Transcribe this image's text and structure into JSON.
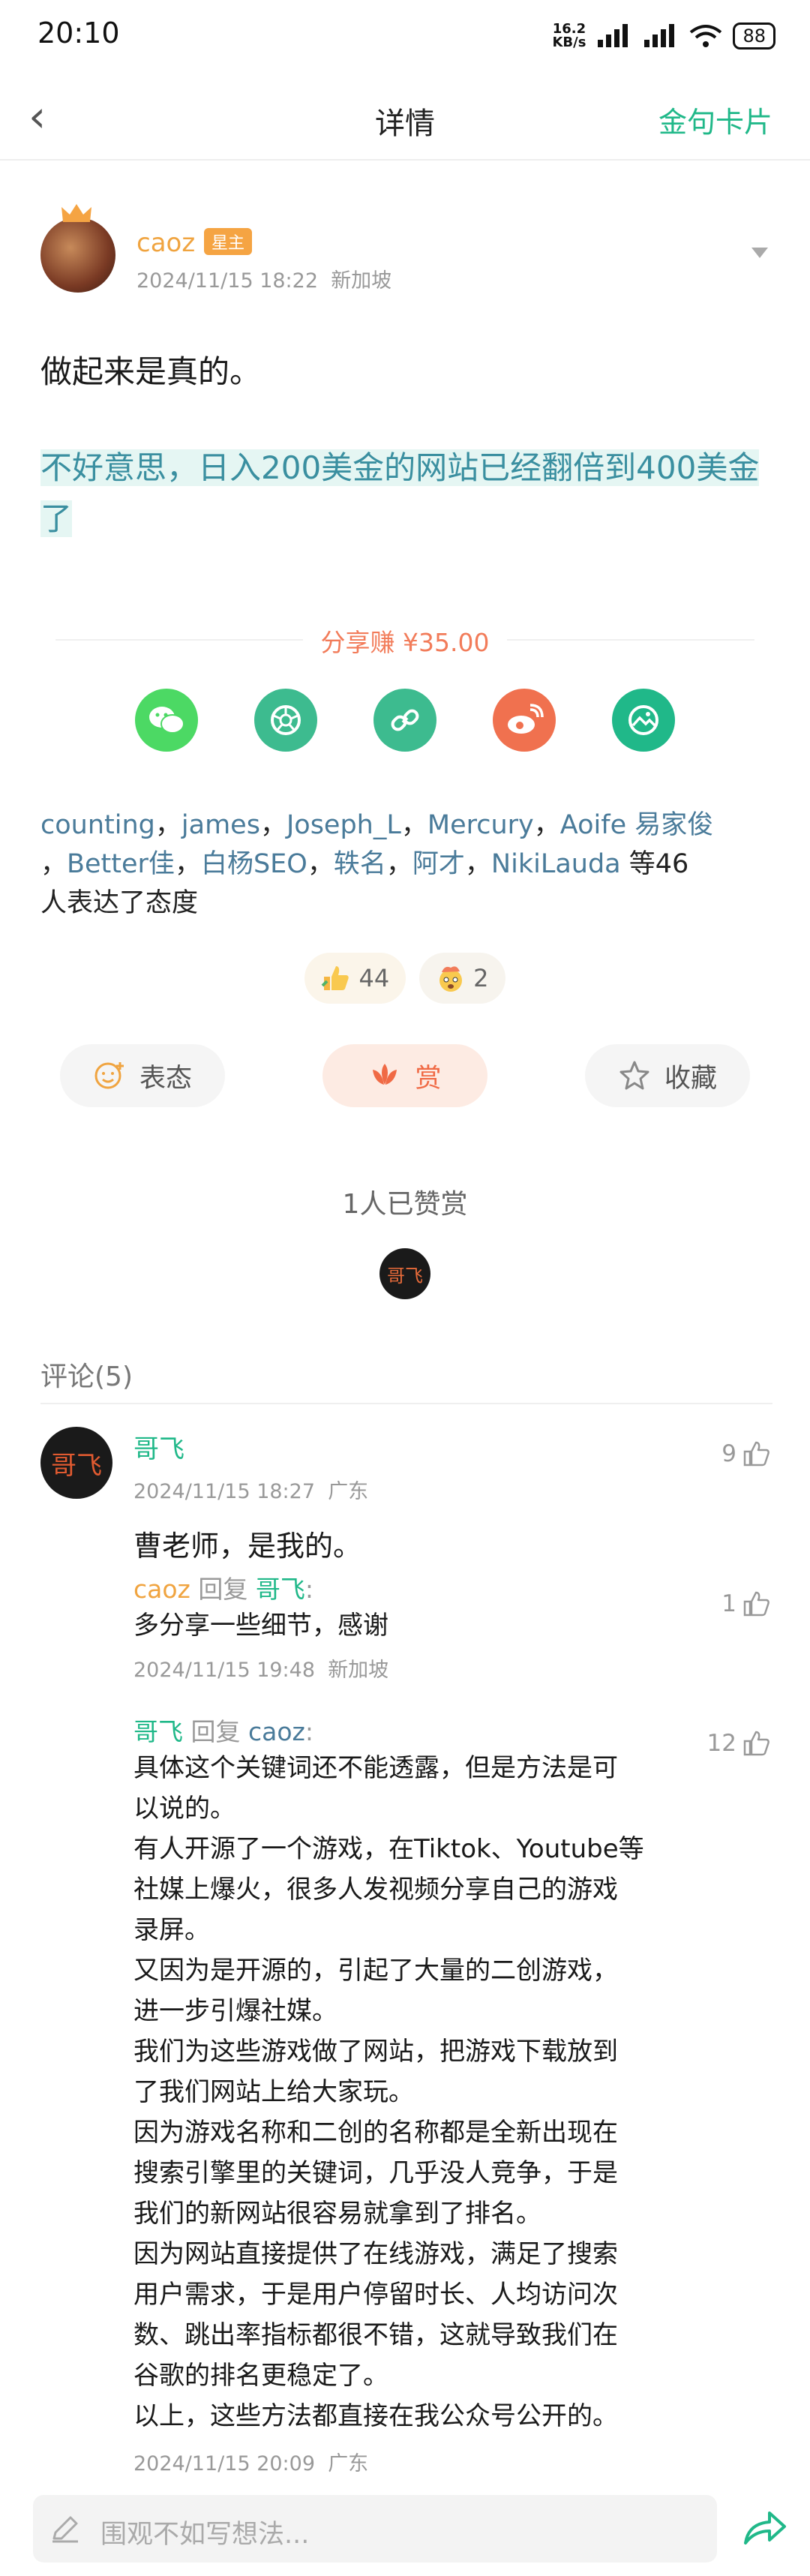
{
  "status_bar": {
    "time": "20:10",
    "speed_value": "16.2",
    "speed_unit": "KB/s",
    "battery": "88"
  },
  "nav": {
    "back_icon": "chevron-left-icon",
    "title": "详情",
    "action": "金句卡片"
  },
  "post": {
    "author": {
      "name": "caoz",
      "badge": "星主",
      "time": "2024/11/15 18:22",
      "location": "新加坡"
    },
    "text_line1": "做起来是真的。",
    "highlight": "不好意思，日入200美金的网站已经翻倍到400美金了"
  },
  "share": {
    "label": "分享赚 ¥35.00",
    "icons": [
      {
        "name": "wechat-icon",
        "color": "#4cd964"
      },
      {
        "name": "moments-icon",
        "color": "#3dbb8f"
      },
      {
        "name": "link-icon",
        "color": "#3dbb8f"
      },
      {
        "name": "weibo-icon",
        "color": "#f0714f"
      },
      {
        "name": "image-card-icon",
        "color": "#20b889"
      }
    ]
  },
  "reactors": {
    "names": [
      "counting",
      "james",
      "Joseph_L",
      "Mercury",
      "Aoife 易家俊",
      "Better佳",
      "白杨SEO",
      "轶名",
      "阿才",
      "NikiLauda"
    ],
    "suffix1": "等46",
    "suffix2": "人表达了态度"
  },
  "reactions": [
    {
      "icon": "thumbs-up-emoji",
      "count": "44"
    },
    {
      "icon": "mind-blown-emoji",
      "count": "2"
    }
  ],
  "actions": {
    "react": "表态",
    "tip": "赏",
    "favorite": "收藏"
  },
  "tips": {
    "count_text": "1人已赞赏",
    "tipper_avatar_text": "哥飞"
  },
  "comments_header": "评论(5)",
  "comment": {
    "avatar_text": "哥飞",
    "author": "哥飞",
    "time": "2024/11/15 18:27",
    "location": "广东",
    "likes": "9",
    "text": "曹老师，是我的。",
    "replies": [
      {
        "from": "caoz",
        "reply_word": "回复",
        "to": "哥飞",
        "likes": "1",
        "lines": [
          "多分享一些细节，感谢"
        ],
        "time": "2024/11/15 19:48",
        "location": "新加坡"
      },
      {
        "from": "哥飞",
        "reply_word": "回复",
        "to": "caoz",
        "likes": "12",
        "lines": [
          "具体这个关键词还不能透露，但是方法是可",
          "以说的。",
          "有人开源了一个游戏，在Tiktok、Youtube等",
          "社媒上爆火，很多人发视频分享自己的游戏",
          "录屏。",
          "又因为是开源的，引起了大量的二创游戏，",
          "进一步引爆社媒。",
          "我们为这些游戏做了网站，把游戏下载放到",
          "了我们网站上给大家玩。",
          "因为游戏名称和二创的名称都是全新出现在",
          "搜索引擎里的关键词，几乎没人竞争，于是",
          "我们的新网站很容易就拿到了排名。",
          "因为网站直接提供了在线游戏，满足了搜索",
          "用户需求，于是用户停留时长、人均访问次",
          "数、跳出率指标都很不错，这就导致我们在",
          "谷歌的排名更稳定了。",
          "以上，这些方法都直接在我公众号公开的。"
        ],
        "time": "2024/11/15 20:09",
        "location": "广东"
      }
    ]
  },
  "bottom": {
    "placeholder": "围观不如写想法..."
  }
}
